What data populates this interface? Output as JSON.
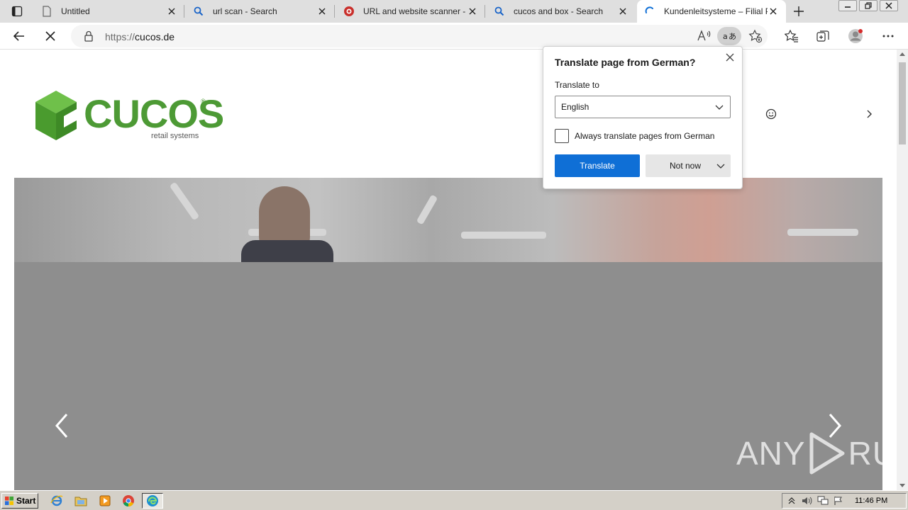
{
  "browser": {
    "tabs": [
      {
        "title": "Untitled",
        "favicon": "page-icon",
        "active": false
      },
      {
        "title": "url scan - Search",
        "favicon": "search-icon",
        "active": false
      },
      {
        "title": "URL and website scanner - urlscan.io",
        "favicon": "urlscan-icon",
        "active": false
      },
      {
        "title": "cucos and box - Search",
        "favicon": "search-icon",
        "active": false
      },
      {
        "title": "Kundenleitsysteme – Filial Pro",
        "favicon": "loading-spinner-icon",
        "active": true
      }
    ],
    "address": {
      "scheme": "https://",
      "host": "cucos.de"
    }
  },
  "page": {
    "logo": {
      "word": "CUCOS",
      "registered": "®",
      "tagline": "retail systems",
      "color": "#4d9a35"
    }
  },
  "translate_popup": {
    "title": "Translate page from German?",
    "label": "Translate to",
    "language": "English",
    "checkbox_label": "Always translate pages from German",
    "checkbox_checked": false,
    "translate_button": "Translate",
    "not_now_button": "Not now",
    "accent": "#0f6fd6"
  },
  "watermark": {
    "left": "ANY",
    "right": "RUN"
  },
  "taskbar": {
    "start_label": "Start",
    "clock": "11:46 PM"
  }
}
